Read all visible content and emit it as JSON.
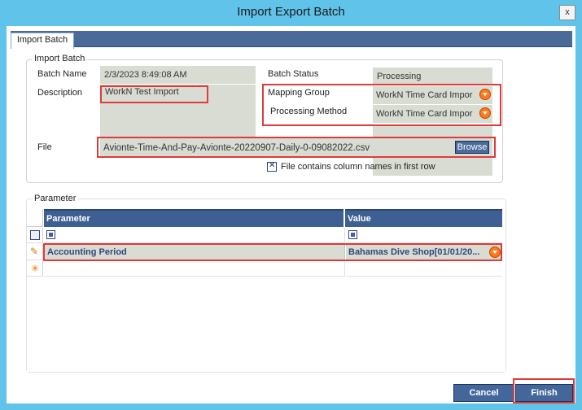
{
  "window": {
    "title": "Import Export Batch",
    "close_glyph": "x"
  },
  "tab": {
    "label": "Import Batch"
  },
  "import_batch": {
    "group_label": "Import Batch",
    "batch_name_label": "Batch Name",
    "batch_name_value": "2/3/2023 8:49:08 AM",
    "description_label": "Description",
    "description_value": "WorkN Test Import",
    "batch_status_label": "Batch Status",
    "batch_status_value": "Processing",
    "mapping_group_label": "Mapping Group",
    "mapping_group_value": "WorkN Time Card Impor",
    "processing_method_label": "Processing Method",
    "processing_method_value": "WorkN Time Card Impor",
    "file_label": "File",
    "file_value": "Avionte-Time-And-Pay-Avionte-20220907-Daily-0-09082022.csv",
    "browse_label": "Browse",
    "header_checkbox_label": "File contains column names in first row",
    "header_checkbox_checked": true
  },
  "parameter": {
    "group_label": "Parameter",
    "columns": [
      "Parameter",
      "Value"
    ],
    "rows": [
      {
        "parameter": "Accounting Period",
        "value": "Bahamas  Dive  Shop[01/01/20..."
      }
    ]
  },
  "buttons": {
    "cancel": "Cancel",
    "finish": "Finish"
  },
  "colors": {
    "accent": "#43679a",
    "highlight": "#e03a3a",
    "title_bar": "#5fc3ea"
  }
}
